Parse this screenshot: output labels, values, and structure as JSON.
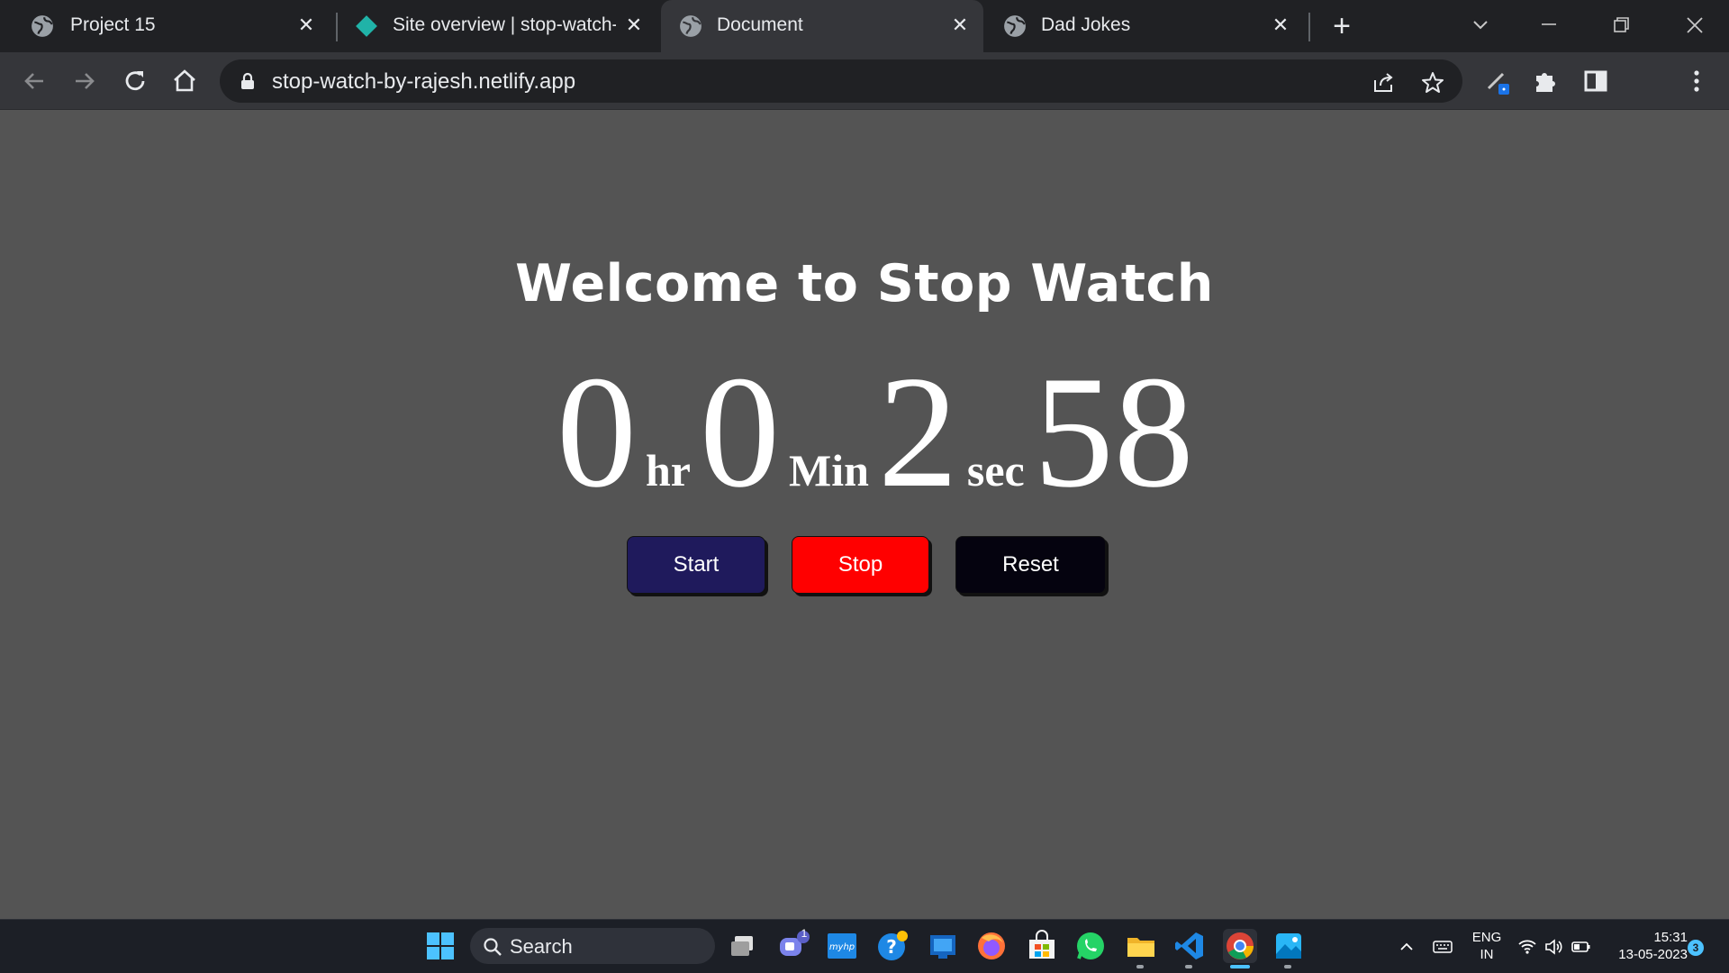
{
  "browser": {
    "tabs": [
      {
        "title": "Project 15"
      },
      {
        "title": "Site overview | stop-watch-"
      },
      {
        "title": "Document"
      },
      {
        "title": "Dad Jokes"
      }
    ],
    "url": "stop-watch-by-rajesh.netlify.app"
  },
  "page": {
    "heading": "Welcome to Stop Watch",
    "clock": {
      "hours": "0",
      "hours_unit": "hr",
      "minutes": "0",
      "minutes_unit": "Min",
      "seconds": "2",
      "seconds_unit": "sec",
      "centiseconds": "58"
    },
    "buttons": {
      "start": "Start",
      "stop": "Stop",
      "reset": "Reset"
    },
    "colors": {
      "background": "#545454",
      "start": "#1f1a5c",
      "stop": "#ff0000",
      "reset": "#05030f"
    }
  },
  "taskbar": {
    "search_label": "Search",
    "chat_badge": "1",
    "lang_top": "ENG",
    "lang_bottom": "IN",
    "time": "15:31",
    "date": "13-05-2023",
    "notification_count": "3"
  }
}
